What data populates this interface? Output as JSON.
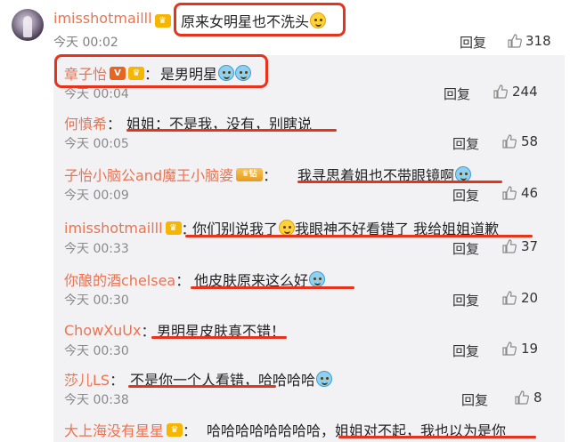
{
  "top_comment": {
    "user": "imisshotmailll",
    "text": "原来女明星也不洗头",
    "time": "今天 00:02",
    "reply_label": "回复",
    "likes": "318"
  },
  "replies": [
    {
      "user": "章子怡",
      "text": "是男明星",
      "time": "今天 00:04",
      "reply_label": "回复",
      "likes": "244"
    },
    {
      "user": "何慎希",
      "text": "姐姐：不是我，没有，别瞎说",
      "time": "今天 00:05",
      "reply_label": "回复",
      "likes": "58"
    },
    {
      "user": "子怡小脑公and魔王小脑婆",
      "text": "我寻思着姐也不带眼镜啊",
      "time": "今天 00:09",
      "reply_label": "回复",
      "likes": "46"
    },
    {
      "user": "imisshotmailll",
      "text_a": "你们别说我了",
      "text_b": "我眼神不好看错了 我给姐姐道歉",
      "time": "今天 00:33",
      "reply_label": "回复",
      "likes": "37"
    },
    {
      "user": "你酿的酒chelsea",
      "text": "他皮肤原来这么好",
      "time": "今天 00:30",
      "reply_label": "回复",
      "likes": "20"
    },
    {
      "user": "ChowXuUx",
      "text": "男明星皮肤真不错！",
      "time": "今天 00:30",
      "reply_label": "回复",
      "likes": "19"
    },
    {
      "user": "莎儿LS",
      "text": "不是你一个人看错，哈哈哈哈",
      "time": "今天 00:38",
      "reply_label": "回复",
      "likes": "8"
    },
    {
      "user": "大上海没有星星",
      "text_a": "哈哈哈哈哈哈哈哈，",
      "text_b": "姐姐对不起，我也以为是你"
    }
  ],
  "colors": {
    "username": "#eb7350",
    "highlight": "#e8331c",
    "panel_bg": "#f2f2f5"
  },
  "icons": [
    "thumbs-up-icon",
    "laughing-emoji",
    "crying-laughing-emoji",
    "vip-badge",
    "verified-badge"
  ]
}
